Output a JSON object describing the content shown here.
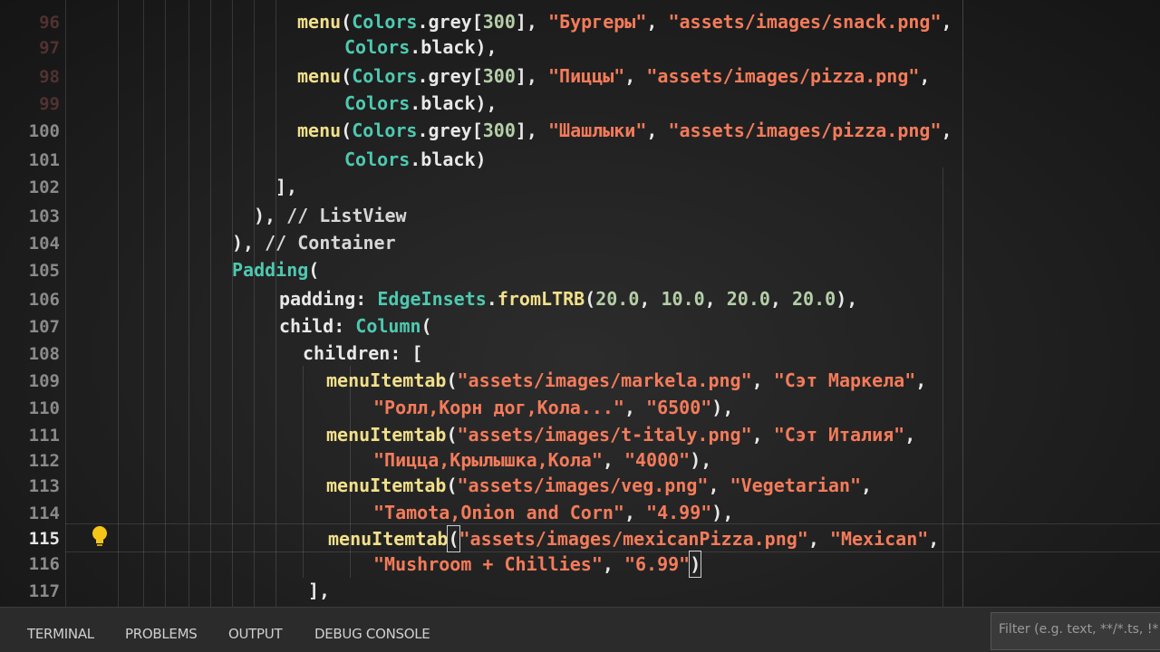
{
  "editor": {
    "line_numbers": [
      "96",
      "97",
      "98",
      "99",
      "100",
      "101",
      "102",
      "103",
      "104",
      "105",
      "106",
      "107",
      "108",
      "109",
      "110",
      "111",
      "112",
      "113",
      "114",
      "115",
      "116",
      "117"
    ],
    "lines": [
      {
        "tokens": [
          [
            "fn",
            "menu"
          ],
          [
            "kw",
            "("
          ],
          [
            "cls",
            "Colors"
          ],
          [
            "kw",
            "."
          ],
          [
            "prop",
            "grey"
          ],
          [
            "kw",
            "["
          ],
          [
            "num",
            "300"
          ],
          [
            "kw",
            "], "
          ],
          [
            "str",
            "\"Бургеры\""
          ],
          [
            "kw",
            ", "
          ],
          [
            "str",
            "\"assets/images/snack.png\""
          ],
          [
            "kw",
            ","
          ]
        ]
      },
      {
        "tokens": [
          [
            "cls",
            "Colors"
          ],
          [
            "kw",
            "."
          ],
          [
            "prop",
            "black"
          ],
          [
            "kw",
            "),"
          ]
        ]
      },
      {
        "tokens": [
          [
            "fn",
            "menu"
          ],
          [
            "kw",
            "("
          ],
          [
            "cls",
            "Colors"
          ],
          [
            "kw",
            "."
          ],
          [
            "prop",
            "grey"
          ],
          [
            "kw",
            "["
          ],
          [
            "num",
            "300"
          ],
          [
            "kw",
            "], "
          ],
          [
            "str",
            "\"Пиццы\""
          ],
          [
            "kw",
            ", "
          ],
          [
            "str",
            "\"assets/images/pizza.png\""
          ],
          [
            "kw",
            ","
          ]
        ]
      },
      {
        "tokens": [
          [
            "cls",
            "Colors"
          ],
          [
            "kw",
            "."
          ],
          [
            "prop",
            "black"
          ],
          [
            "kw",
            "),"
          ]
        ]
      },
      {
        "tokens": [
          [
            "fn",
            "menu"
          ],
          [
            "kw",
            "("
          ],
          [
            "cls",
            "Colors"
          ],
          [
            "kw",
            "."
          ],
          [
            "prop",
            "grey"
          ],
          [
            "kw",
            "["
          ],
          [
            "num",
            "300"
          ],
          [
            "kw",
            "], "
          ],
          [
            "str",
            "\"Шашлыки\""
          ],
          [
            "kw",
            ", "
          ],
          [
            "str",
            "\"assets/images/pizza.png\""
          ],
          [
            "kw",
            ","
          ]
        ]
      },
      {
        "tokens": [
          [
            "cls",
            "Colors"
          ],
          [
            "kw",
            "."
          ],
          [
            "prop",
            "black"
          ],
          [
            "kw",
            ")"
          ]
        ]
      },
      {
        "tokens": [
          [
            "kw",
            "],"
          ]
        ]
      },
      {
        "tokens": [
          [
            "kw",
            "), "
          ],
          [
            "cmt",
            "// ListView"
          ]
        ]
      },
      {
        "tokens": [
          [
            "kw",
            "), "
          ],
          [
            "cmt",
            "// Container"
          ]
        ]
      },
      {
        "tokens": [
          [
            "cls",
            "Padding"
          ],
          [
            "kw",
            "("
          ]
        ]
      },
      {
        "tokens": [
          [
            "prop",
            "padding: "
          ],
          [
            "cls",
            "EdgeInsets"
          ],
          [
            "kw",
            "."
          ],
          [
            "fn",
            "fromLTRB"
          ],
          [
            "kw",
            "("
          ],
          [
            "num",
            "20.0"
          ],
          [
            "kw",
            ", "
          ],
          [
            "num",
            "10.0"
          ],
          [
            "kw",
            ", "
          ],
          [
            "num",
            "20.0"
          ],
          [
            "kw",
            ", "
          ],
          [
            "num",
            "20.0"
          ],
          [
            "kw",
            "),"
          ]
        ]
      },
      {
        "tokens": [
          [
            "prop",
            "child: "
          ],
          [
            "cls",
            "Column"
          ],
          [
            "kw",
            "("
          ]
        ]
      },
      {
        "tokens": [
          [
            "prop",
            "children: "
          ],
          [
            "kw",
            "["
          ]
        ]
      },
      {
        "tokens": [
          [
            "fn",
            "menuItemtab"
          ],
          [
            "kw",
            "("
          ],
          [
            "str",
            "\"assets/images/markela.png\""
          ],
          [
            "kw",
            ", "
          ],
          [
            "str",
            "\"Сэт Маркела\""
          ],
          [
            "kw",
            ","
          ]
        ]
      },
      {
        "tokens": [
          [
            "str",
            "\"Ролл,Корн дог,Кола...\""
          ],
          [
            "kw",
            ", "
          ],
          [
            "str",
            "\"6500\""
          ],
          [
            "kw",
            "),"
          ]
        ]
      },
      {
        "tokens": [
          [
            "fn",
            "menuItemtab"
          ],
          [
            "kw",
            "("
          ],
          [
            "str",
            "\"assets/images/t-italy.png\""
          ],
          [
            "kw",
            ", "
          ],
          [
            "str",
            "\"Сэт Италия\""
          ],
          [
            "kw",
            ","
          ]
        ]
      },
      {
        "tokens": [
          [
            "str",
            "\"Пицца,Крылышка,Кола\""
          ],
          [
            "kw",
            ", "
          ],
          [
            "str",
            "\"4000\""
          ],
          [
            "kw",
            "),"
          ]
        ]
      },
      {
        "tokens": [
          [
            "fn",
            "menuItemtab"
          ],
          [
            "kw",
            "("
          ],
          [
            "str",
            "\"assets/images/veg.png\""
          ],
          [
            "kw",
            ", "
          ],
          [
            "str",
            "\"Vegetarian\""
          ],
          [
            "kw",
            ","
          ]
        ]
      },
      {
        "tokens": [
          [
            "str",
            "\"Tamota,Onion and Corn\""
          ],
          [
            "kw",
            ", "
          ],
          [
            "str",
            "\"4.99\""
          ],
          [
            "kw",
            "),"
          ]
        ]
      },
      {
        "tokens": [
          [
            "fn",
            "menuItemtab"
          ],
          [
            "cursor",
            "("
          ],
          [
            "str",
            "\"assets/images/mexicanPizza.png\""
          ],
          [
            "kw",
            ", "
          ],
          [
            "str",
            "\"Mexican\""
          ],
          [
            "kw",
            ","
          ]
        ]
      },
      {
        "tokens": [
          [
            "str",
            "\"Mushroom + Chillies\""
          ],
          [
            "kw",
            ", "
          ],
          [
            "str",
            "\"6.99\""
          ],
          [
            "cursor",
            ")"
          ]
        ]
      },
      {
        "tokens": [
          [
            "kw",
            "],"
          ]
        ]
      }
    ]
  },
  "panel": {
    "tabs": [
      "TERMINAL",
      "PROBLEMS",
      "OUTPUT",
      "DEBUG CONSOLE"
    ],
    "filter_placeholder": "Filter (e.g. text, **/*.ts, !*"
  }
}
